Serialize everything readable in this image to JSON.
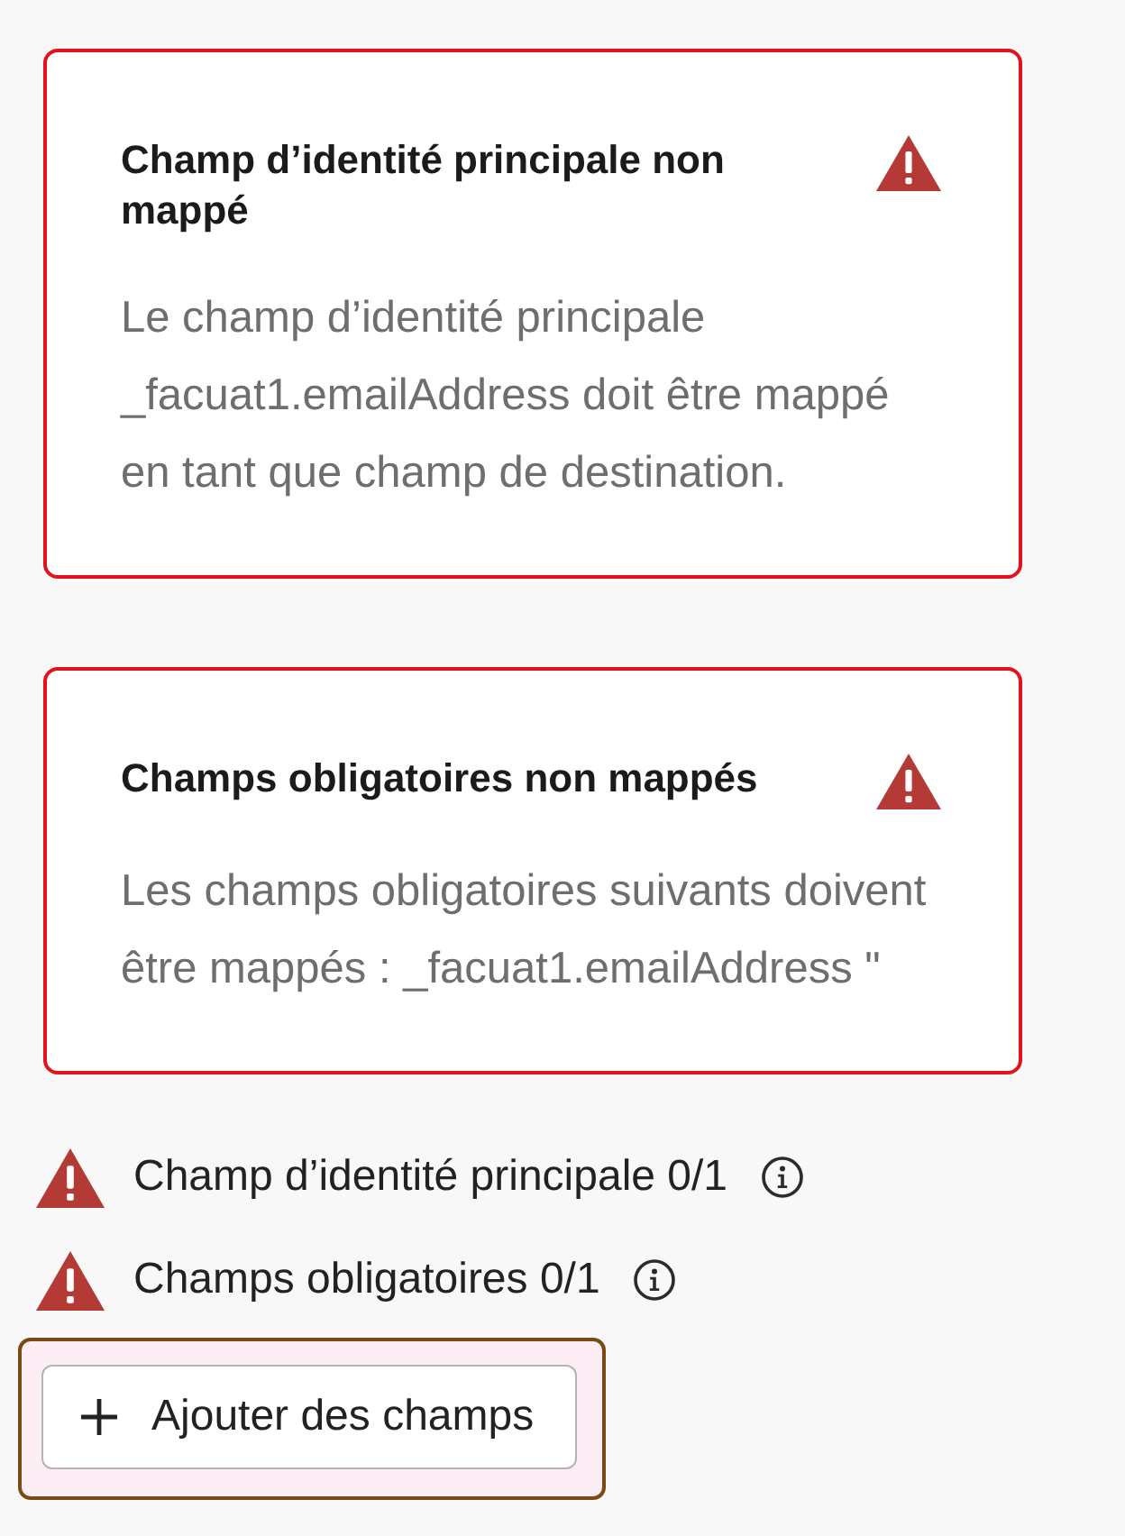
{
  "alerts": [
    {
      "title": "Champ d’identité principale non mappé",
      "message": "Le champ d’identité principale _facuat1.emailAddress doit être mappé en tant que champ de destination."
    },
    {
      "title": "Champs obligatoires non mappés",
      "message": "Les champs obligatoires suivants doivent être mappés : _facuat1.emailAddress \""
    }
  ],
  "requirements": [
    {
      "label": "Champ d’identité principale 0/1"
    },
    {
      "label": "Champs obligatoires 0/1"
    }
  ],
  "add_button": {
    "label": "Ajouter des champs",
    "highlighted": true
  }
}
